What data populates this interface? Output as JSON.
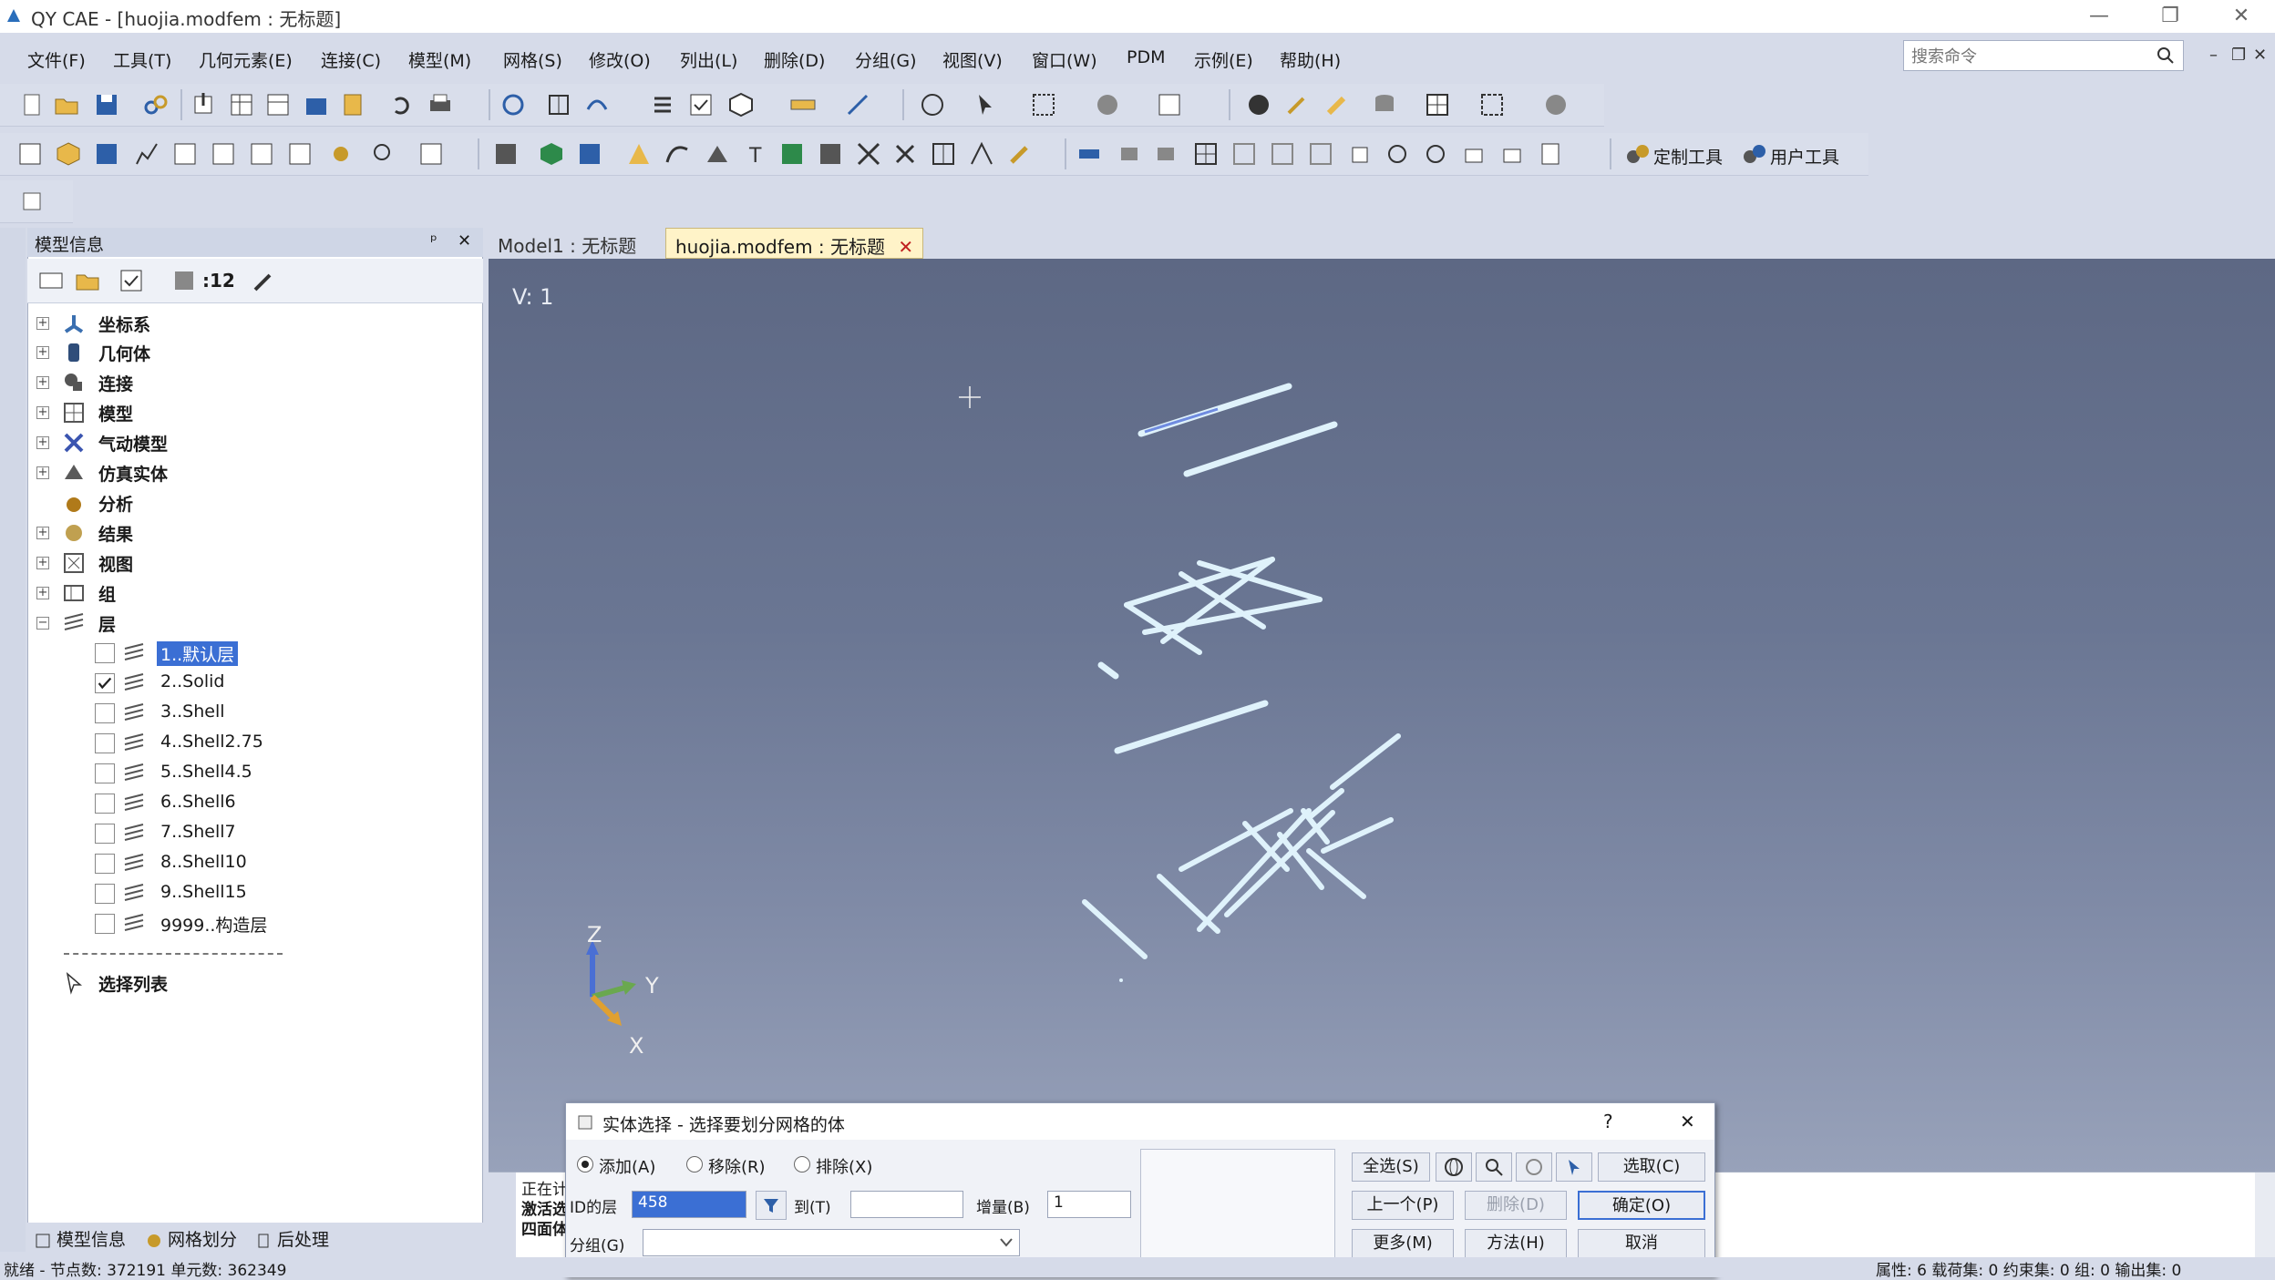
{
  "window": {
    "title": "QY CAE - [huojia.modfem : 无标题]",
    "minimize": "—",
    "restore": "❐",
    "close": "✕"
  },
  "menu": {
    "items": [
      "文件(F)",
      "工具(T)",
      "几何元素(E)",
      "连接(C)",
      "模型(M)",
      "网格(S)",
      "修改(O)",
      "列出(L)",
      "删除(D)",
      "分组(G)",
      "视图(V)",
      "窗口(W)",
      "PDM",
      "示例(E)",
      "帮助(H)"
    ],
    "search_placeholder": "搜索命令",
    "mdi_minimize": "–",
    "mdi_restore": "❐",
    "mdi_close": "✕"
  },
  "toolbar": {
    "custom_tools": "定制工具",
    "user_tools": "用户工具"
  },
  "left_panel": {
    "title": "模型信息",
    "pin": "ᵖ",
    "close": "✕",
    "count_label": ":12",
    "tree": [
      {
        "label": "坐标系",
        "icon": "axes-icon",
        "color": "#3a6fb0"
      },
      {
        "label": "几何体",
        "icon": "solid-icon",
        "color": "#2f4d7a"
      },
      {
        "label": "连接",
        "icon": "connection-icon",
        "color": "#555555"
      },
      {
        "label": "模型",
        "icon": "grid-icon",
        "color": "#555555"
      },
      {
        "label": "气动模型",
        "icon": "aero-icon",
        "color": "#3b55b0"
      },
      {
        "label": "仿真实体",
        "icon": "sim-icon",
        "color": "#5a5a5a"
      },
      {
        "label": "分析",
        "icon": "analysis-icon",
        "color": "#b07a1a"
      },
      {
        "label": "结果",
        "icon": "result-icon",
        "color": "#c0a050"
      },
      {
        "label": "视图",
        "icon": "view-icon",
        "color": "#555555"
      },
      {
        "label": "组",
        "icon": "group-icon",
        "color": "#555555"
      },
      {
        "label": "层",
        "icon": "layer-icon",
        "color": "#555555"
      }
    ],
    "layers": [
      {
        "label": "1..默认层",
        "checked": false,
        "selected": true
      },
      {
        "label": "2..Solid",
        "checked": true,
        "selected": false
      },
      {
        "label": "3..Shell",
        "checked": false,
        "selected": false
      },
      {
        "label": "4..Shell2.75",
        "checked": false,
        "selected": false
      },
      {
        "label": "5..Shell4.5",
        "checked": false,
        "selected": false
      },
      {
        "label": "6..Shell6",
        "checked": false,
        "selected": false
      },
      {
        "label": "7..Shell7",
        "checked": false,
        "selected": false
      },
      {
        "label": "8..Shell10",
        "checked": false,
        "selected": false
      },
      {
        "label": "9..Shell15",
        "checked": false,
        "selected": false
      },
      {
        "label": "9999..构造层",
        "checked": false,
        "selected": false
      }
    ],
    "selection_list": "选择列表",
    "tabs": [
      "模型信息",
      "网格划分",
      "后处理"
    ]
  },
  "doc_tabs": [
    {
      "label": "Model1 : 无标题",
      "active": false
    },
    {
      "label": "huojia.modfem : 无标题",
      "active": true
    }
  ],
  "viewport": {
    "view_label": "V: 1",
    "axis_z": "Z",
    "axis_y": "Y",
    "axis_x": "X"
  },
  "output": {
    "lines": [
      "正在计算网格大小...",
      "激活选择实体",
      "四面体网格"
    ]
  },
  "dialog": {
    "title": "实体选择 - 选择要划分网格的体",
    "help": "?",
    "close": "✕",
    "radio_add": "添加(A)",
    "radio_remove": "移除(R)",
    "radio_exclude": "排除(X)",
    "id_label": "ID的层",
    "id_value": "458",
    "to_label": "到(T)",
    "to_value": "",
    "increment_label": "增量(B)",
    "increment_value": "1",
    "group_label": "分组(G)",
    "group_value": "",
    "btn_select_all": "全选(S)",
    "btn_select": "选取(C)",
    "btn_prev": "上一个(P)",
    "btn_reset": "删除(D)",
    "btn_ok": "确定(O)",
    "btn_more": "更多(M)",
    "btn_method": "方法(H)",
    "btn_cancel": "取消"
  },
  "status": {
    "left": "就绪 - 节点数: 372191  单元数: 362349",
    "right": "属性: 6   载荷集: 0   约束集: 0   组: 0   输出集: 0"
  },
  "colors": {
    "accent": "#3b6fd4",
    "viewport_top": "#5d6884",
    "viewport_bottom": "#98a2ba",
    "part": "#d8eef8"
  }
}
